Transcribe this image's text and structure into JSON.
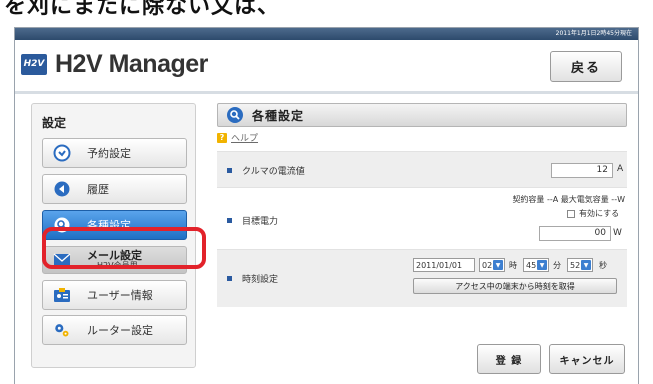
{
  "top_strip_text": "を刈にまたに除ない文は、",
  "window": {
    "datetime": "2011年1月1日2時45分現在",
    "app_title": "H2V Manager",
    "logo_abbr": "H2V",
    "back_label": "戻る"
  },
  "sidebar": {
    "title": "設定",
    "items": [
      {
        "label": "予約設定",
        "icon": "clock-icon"
      },
      {
        "label": "履歴",
        "icon": "back-arrow-icon"
      },
      {
        "label": "各種設定",
        "icon": "search-gear-icon",
        "active": true
      },
      {
        "label": "メール設定",
        "sublabel": "H2V会員用",
        "icon": "mail-icon"
      },
      {
        "label": "ユーザー情報",
        "icon": "user-card-icon"
      },
      {
        "label": "ルーター設定",
        "icon": "gears-icon"
      }
    ]
  },
  "main": {
    "title": "各種設定",
    "help_label": "ヘルプ",
    "help_icon_text": "?",
    "rows": {
      "current_limit": {
        "label": "クルマの電流値",
        "value": "12",
        "unit": "A"
      },
      "target_power": {
        "label": "目標電力",
        "contract_info": "契約容量 --A 最大電気容量 --W",
        "enable_label": "有効にする",
        "value": "00",
        "unit": "W"
      },
      "time_setting": {
        "label": "時刻設定",
        "date": "2011/01/01",
        "hour": "02",
        "hour_unit": "時",
        "minute": "45",
        "minute_unit": "分",
        "second": "52",
        "second_unit": "秒",
        "sync_button": "アクセス中の端末から時刻を取得"
      }
    },
    "save_label": "登 録",
    "cancel_label": "キャンセル"
  },
  "colors": {
    "accent": "#1f6fc4",
    "highlight": "#e2222a",
    "header_bar": "#2d4a6c"
  }
}
